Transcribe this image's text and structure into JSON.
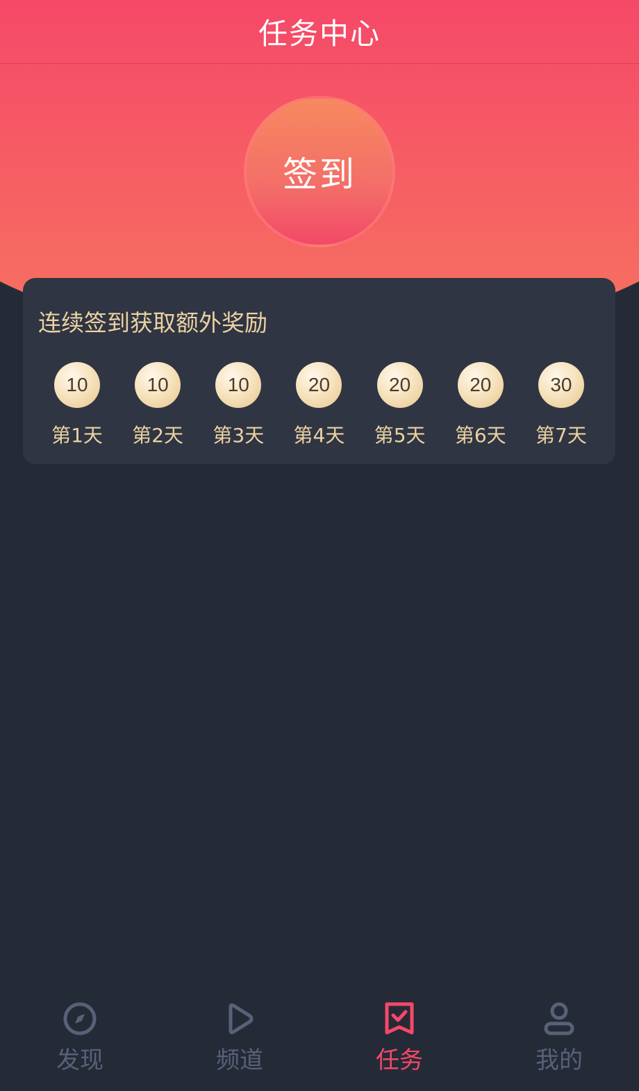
{
  "header": {
    "title": "任务中心"
  },
  "checkin": {
    "label": "签到"
  },
  "reward_card": {
    "title": "连续签到获取额外奖励",
    "days": [
      {
        "points": "10",
        "label": "第1天"
      },
      {
        "points": "10",
        "label": "第2天"
      },
      {
        "points": "10",
        "label": "第3天"
      },
      {
        "points": "20",
        "label": "第4天"
      },
      {
        "points": "20",
        "label": "第5天"
      },
      {
        "points": "20",
        "label": "第6天"
      },
      {
        "points": "30",
        "label": "第7天"
      }
    ]
  },
  "tabbar": {
    "tabs": [
      {
        "label": "发现",
        "icon": "compass-icon",
        "active": false
      },
      {
        "label": "频道",
        "icon": "play-icon",
        "active": false
      },
      {
        "label": "任务",
        "icon": "task-check-icon",
        "active": true
      },
      {
        "label": "我的",
        "icon": "user-icon",
        "active": false
      }
    ]
  },
  "colors": {
    "brand": "#f54868",
    "background": "#252a37",
    "card": "#2f3542",
    "gold_text": "#ecd2a3",
    "inactive_tab": "#576178"
  }
}
